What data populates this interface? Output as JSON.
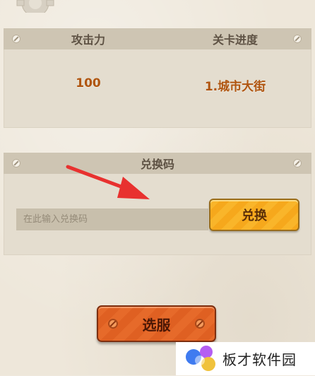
{
  "stats": {
    "attack_label": "攻击力",
    "progress_label": "关卡进度",
    "attack_value": "100",
    "progress_value": "1.城市大街"
  },
  "redeem": {
    "title": "兑换码",
    "input_placeholder": "在此输入兑换码",
    "input_value": "",
    "button_label": "兑换"
  },
  "server_button_label": "选服",
  "watermark": {
    "text": "板才软件园"
  },
  "colors": {
    "accent_orange": "#e66a2a",
    "accent_yellow": "#f9b52a",
    "value_text": "#b0550f",
    "arrow": "#e8312f"
  },
  "icons": [
    "gear-icon",
    "bolt-icon",
    "arrow-icon",
    "nail-icon"
  ]
}
